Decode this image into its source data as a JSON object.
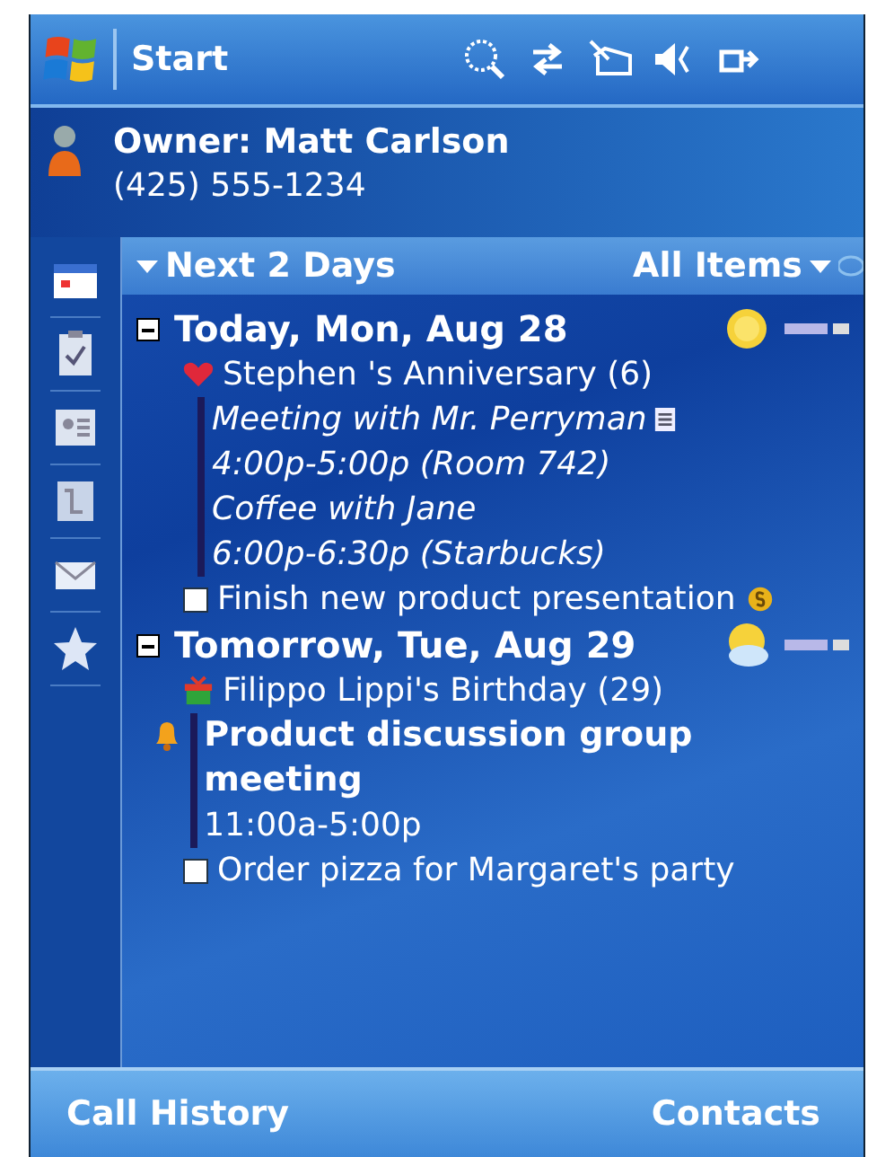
{
  "status_bar": {
    "start_label": "Start"
  },
  "owner": {
    "name": "Owner: Matt Carlson",
    "phone": "(425) 555-1234"
  },
  "filter_bar": {
    "range_label": "Next 2 Days",
    "filter_label": "All Items"
  },
  "days": [
    {
      "title": "Today, Mon, Aug 28",
      "expanded": true,
      "weather": {
        "kind": "sunny"
      },
      "items": [
        {
          "kind": "anniversary",
          "text": "Stephen 's Anniversary (6)"
        },
        {
          "kind": "appointment",
          "title": "Meeting with Mr. Perryman",
          "time": "4:00p-5:00p (Room 742)",
          "italic": true,
          "bold": false,
          "alarm": false,
          "note": true
        },
        {
          "kind": "appointment",
          "title": "Coffee with Jane",
          "time": "6:00p-6:30p (Starbucks)",
          "italic": true,
          "bold": false,
          "alarm": false,
          "note": false
        },
        {
          "kind": "task",
          "text": "Finish new product presentation",
          "checked": false,
          "coin": true
        }
      ]
    },
    {
      "title": "Tomorrow, Tue, Aug 29",
      "expanded": true,
      "weather": {
        "kind": "partly-cloudy"
      },
      "items": [
        {
          "kind": "birthday",
          "text": "Filippo Lippi's Birthday (29)"
        },
        {
          "kind": "appointment",
          "title": "Product discussion group meeting",
          "time": "11:00a-5:00p",
          "italic": false,
          "bold": true,
          "alarm": true,
          "note": false
        },
        {
          "kind": "task",
          "text": "Order pizza for Margaret's party",
          "checked": false,
          "coin": false
        }
      ]
    }
  ],
  "softkeys": [
    "Call History",
    "Contacts"
  ]
}
